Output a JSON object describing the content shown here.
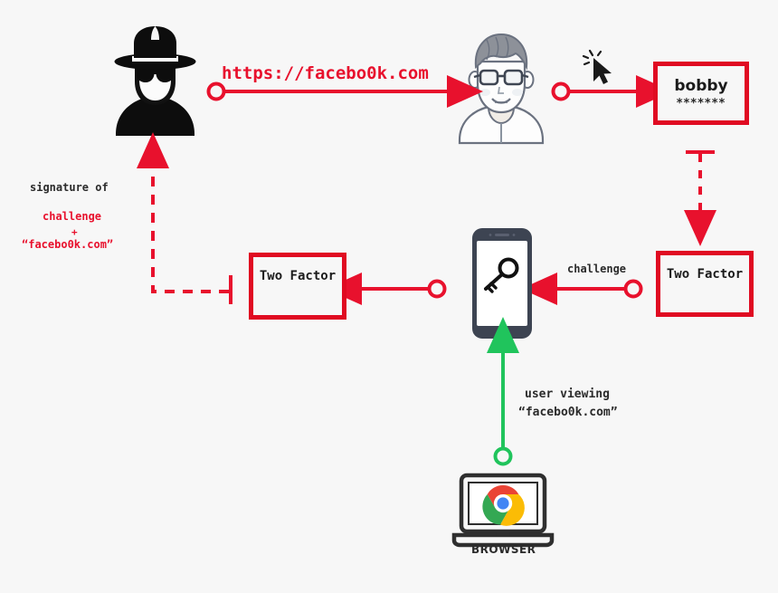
{
  "diagram": {
    "title": "Phishing attack with two-factor authentication flow",
    "background_color": "#f7f7f7",
    "accent_red": "#e00b22",
    "accent_green": "#20c45c",
    "dark": "#2b2b2b"
  },
  "nodes": {
    "attacker": {
      "name": "attacker-spy-avatar",
      "icon": "spy-icon"
    },
    "victim": {
      "name": "victim-user-avatar",
      "icon": "user-avatar-icon"
    },
    "credentials_box": {
      "username": "bobby",
      "password_mask": "*******"
    },
    "two_factor_right": {
      "label": "Two Factor",
      "icon": "lock-icon"
    },
    "two_factor_left": {
      "label": "Two Factor",
      "icon": "lock-icon"
    },
    "phone": {
      "name": "phone-security-key",
      "icon": "key-icon"
    },
    "browser": {
      "label": "BROWSER",
      "icon": "chrome-icon"
    },
    "cursor": {
      "icon": "mouse-cursor-click-icon"
    }
  },
  "labels": {
    "phishing_url": "https://facebo0k.com",
    "signature_of": "signature of",
    "challenge_red": "challenge",
    "plus": "+",
    "domain_quoted": "“facebo0k.com”",
    "challenge": "challenge",
    "user_viewing_line1": "user viewing",
    "user_viewing_line2": "“facebo0k.com”"
  }
}
